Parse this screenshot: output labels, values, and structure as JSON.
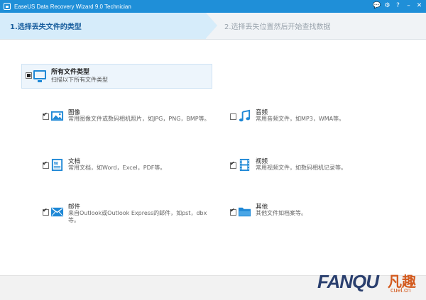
{
  "window": {
    "title": "EaseUS Data Recovery Wizard 9.0 Technician",
    "controls": [
      "💬",
      "⚙",
      "?",
      "–",
      "✕"
    ]
  },
  "steps": {
    "step1": "1.选择丢失文件的类型",
    "step2": "2.选择丢失位置然后开始查找数据"
  },
  "all_types": {
    "title": "所有文件类型",
    "desc": "扫描以下所有文件类型",
    "state": "partial"
  },
  "file_types": [
    {
      "name": "图像",
      "desc": "常用图像文件或数码相机照片，如JPG，PNG，BMP等。",
      "checked": true,
      "icon": "image-icon"
    },
    {
      "name": "音频",
      "desc": "常用音频文件，如MP3，WMA等。",
      "checked": false,
      "icon": "music-icon"
    },
    {
      "name": "文档",
      "desc": "常用文档，如Word，Excel，PDF等。",
      "checked": true,
      "icon": "document-icon"
    },
    {
      "name": "视频",
      "desc": "常用视频文件，如数码相机记录等。",
      "checked": true,
      "icon": "film-icon"
    },
    {
      "name": "邮件",
      "desc": "来自Outlook或Outlook Express的邮件，如pst，dbx等。",
      "checked": true,
      "icon": "mail-icon"
    },
    {
      "name": "其他",
      "desc": "其他文件如档案等。",
      "checked": true,
      "icon": "folder-icon"
    }
  ],
  "watermark": {
    "brand": "FANQU",
    "cn": "凡趣",
    "domain": "cuel.cn"
  },
  "colors": {
    "accent": "#1f8fd8",
    "step_active_bg": "#d6ecfa"
  }
}
